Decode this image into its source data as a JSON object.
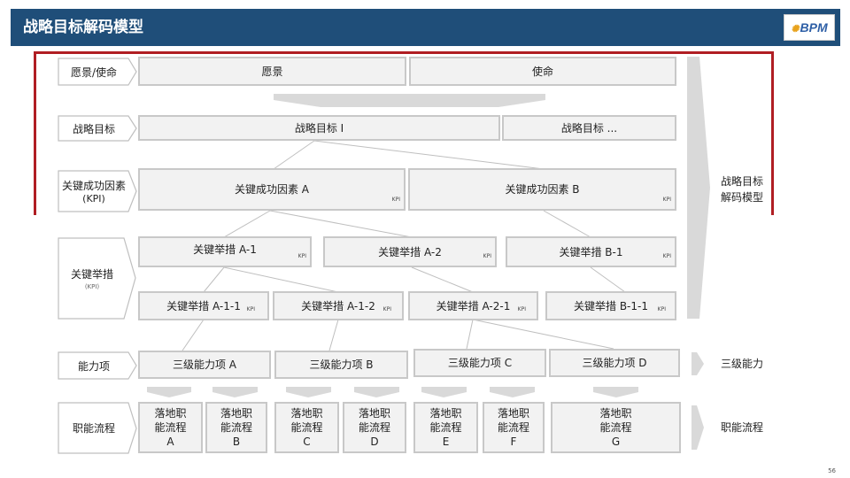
{
  "header": {
    "title": "战略目标解码模型",
    "logo": "BPM"
  },
  "left_labels": {
    "vision": "愿景/使命",
    "goals": "战略目标",
    "csf": "关键成功因素",
    "csf_sub": "(KPI)",
    "actions": "关键举措",
    "actions_sub": "(KPI)",
    "capability": "能力项",
    "process": "职能流程"
  },
  "boxes": {
    "vision": "愿景",
    "mission": "使命",
    "goal1": "战略目标 Ⅰ",
    "goal2": "战略目标 ...",
    "csfA": "关键成功因素 A",
    "csfB": "关键成功因素 B",
    "a1": "关键举措 A-1",
    "a2": "关键举措 A-2",
    "b1": "关键举措 B-1",
    "a11": "关键举措 A-1-1",
    "a12": "关键举措 A-1-2",
    "a21": "关键举措 A-2-1",
    "b11": "关键举措 B-1-1",
    "capA": "三级能力项 A",
    "capB": "三级能力项 B",
    "capC": "三级能力项 C",
    "capD": "三级能力项 D",
    "kpi": "KPI"
  },
  "processes": [
    {
      "l1": "落地职",
      "l2": "能流程",
      "l3": "A"
    },
    {
      "l1": "落地职",
      "l2": "能流程",
      "l3": "B"
    },
    {
      "l1": "落地职",
      "l2": "能流程",
      "l3": "C"
    },
    {
      "l1": "落地职",
      "l2": "能流程",
      "l3": "D"
    },
    {
      "l1": "落地职",
      "l2": "能流程",
      "l3": "E"
    },
    {
      "l1": "落地职",
      "l2": "能流程",
      "l3": "F"
    },
    {
      "l1": "落地职",
      "l2": "能流程",
      "l3": "G"
    }
  ],
  "side": {
    "model_l1": "战略目标",
    "model_l2": "解码模型",
    "capability": "三级能力",
    "process": "职能流程"
  },
  "page_number": "56",
  "colors": {
    "header": "#1f4e79",
    "frame": "#b01e23",
    "box_fill": "#f2f2f2",
    "box_border": "#c8c8c8",
    "arrow": "#d9d9d9"
  }
}
